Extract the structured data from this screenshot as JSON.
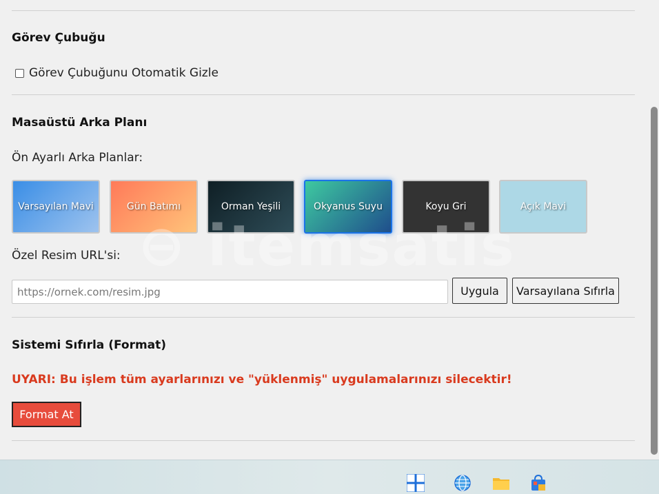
{
  "taskbar_section": {
    "heading": "Görev Çubuğu",
    "autohide_label": "Görev Çubuğunu Otomatik Gizle",
    "autohide_checked": false
  },
  "background_section": {
    "heading": "Masaüstü Arka Planı",
    "presets_label": "Ön Ayarlı Arka Planlar:",
    "presets": [
      {
        "label": "Varsayılan Mavi",
        "gradient": [
          "#3a8ee6",
          "#9ec3ee"
        ]
      },
      {
        "label": "Gün Batımı",
        "gradient": [
          "#ff7a59",
          "#ffc37a"
        ]
      },
      {
        "label": "Orman Yeşili",
        "gradient": [
          "#0f1f25",
          "#2e4c57"
        ]
      },
      {
        "label": "Okyanus Suyu",
        "gradient": [
          "#3ec9a0",
          "#1f4e8c"
        ],
        "selected": true
      },
      {
        "label": "Koyu Gri",
        "gradient": [
          "#333333",
          "#333333"
        ]
      },
      {
        "label": "Açık Mavi",
        "gradient": [
          "#add8e6",
          "#add8e6"
        ]
      }
    ],
    "custom_url_label": "Özel Resim URL'si:",
    "url_placeholder": "https://ornek.com/resim.jpg",
    "apply_button": "Uygula",
    "reset_button": "Varsayılana Sıfırla"
  },
  "reset_section": {
    "heading": "Sistemi Sıfırla (Format)",
    "warning": "UYARI: Bu işlem tüm ayarlarınızı ve \"yüklenmiş\" uygulamalarınızı silecektir!",
    "format_button": "Format At"
  },
  "taskbar": {
    "icons": [
      "start-icon",
      "browser-globe-icon",
      "folder-icon",
      "store-bag-icon"
    ]
  },
  "colors": {
    "warning": "#d93a1e",
    "format_button": "#e74c3c",
    "selected_border": "#1a73e8"
  }
}
